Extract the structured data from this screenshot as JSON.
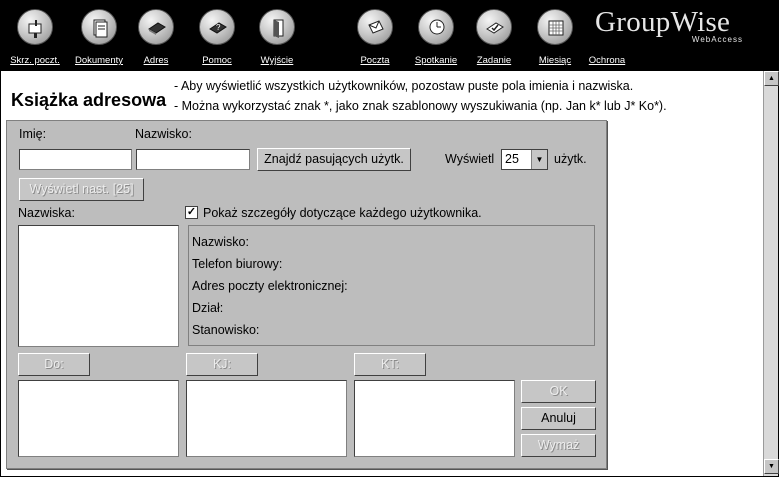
{
  "toolbar": {
    "items": [
      {
        "label": "Skrz. poczt.",
        "icon": "mailbox-icon"
      },
      {
        "label": "Dokumenty",
        "icon": "documents-icon"
      },
      {
        "label": "Adres",
        "icon": "address-book-icon"
      },
      {
        "label": "Pomoc",
        "icon": "help-icon"
      },
      {
        "label": "Wyjście",
        "icon": "exit-icon"
      },
      {
        "label": "Poczta",
        "icon": "mail-icon"
      },
      {
        "label": "Spotkanie",
        "icon": "appointment-icon"
      },
      {
        "label": "Zadanie",
        "icon": "task-icon"
      },
      {
        "label": "Miesiąc",
        "icon": "calendar-icon"
      },
      {
        "label": "Ochrona",
        "icon": "security-icon"
      }
    ],
    "logo_main": "GroupWise",
    "logo_sub": "WebAccess"
  },
  "header": {
    "title": "Książka adresowa",
    "hint1": "- Aby wyświetlić wszystkich użytkowników, pozostaw puste pola imienia i nazwiska.",
    "hint2": "- Można wykorzystać znak *, jako znak szablonowy wyszukiwania (np. Jan k* lub J* Ko*)."
  },
  "search": {
    "first_name_label": "Imię:",
    "first_name_value": "",
    "last_name_label": "Nazwisko:",
    "last_name_value": "",
    "find_button": "Znajdź pasujących użytk.",
    "show_label": "Wyświetl",
    "show_count": "25",
    "show_suffix": "użytk.",
    "next_button": "Wyświetl nast. [25]"
  },
  "names": {
    "label": "Nazwiska:",
    "details_checkbox_label": "Pokaż szczegóły dotyczące każdego użytkownika.",
    "details_checked": true
  },
  "details": {
    "name": "Nazwisko:",
    "phone": "Telefon biurowy:",
    "email": "Adres poczty elektronicznej:",
    "department": "Dział:",
    "title": "Stanowisko:"
  },
  "recipients": {
    "to_button": "Do:",
    "cc_button": "KJ:",
    "bc_button": "KT:"
  },
  "actions": {
    "ok": "OK",
    "cancel": "Anuluj",
    "clear": "Wymaż"
  }
}
